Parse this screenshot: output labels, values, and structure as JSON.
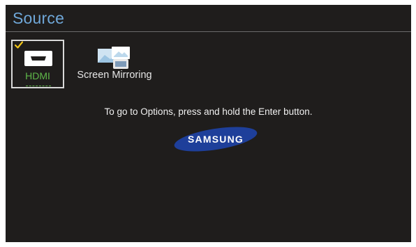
{
  "page": {
    "title": "Source"
  },
  "sources": [
    {
      "label": "HDMI",
      "selected": true,
      "icon": "hdmi-icon"
    },
    {
      "label": "Screen Mirroring",
      "selected": false,
      "icon": "screen-mirroring-icon"
    }
  ],
  "hint": {
    "text": "To go to Options, press and hold the Enter button."
  },
  "brand": {
    "name": "SAMSUNG"
  },
  "colors": {
    "background": "#1f1d1c",
    "title": "#6fa7d8",
    "selected_label": "#5fb84a",
    "check": "#f0c419",
    "logo_blue": "#1e3f9a"
  }
}
